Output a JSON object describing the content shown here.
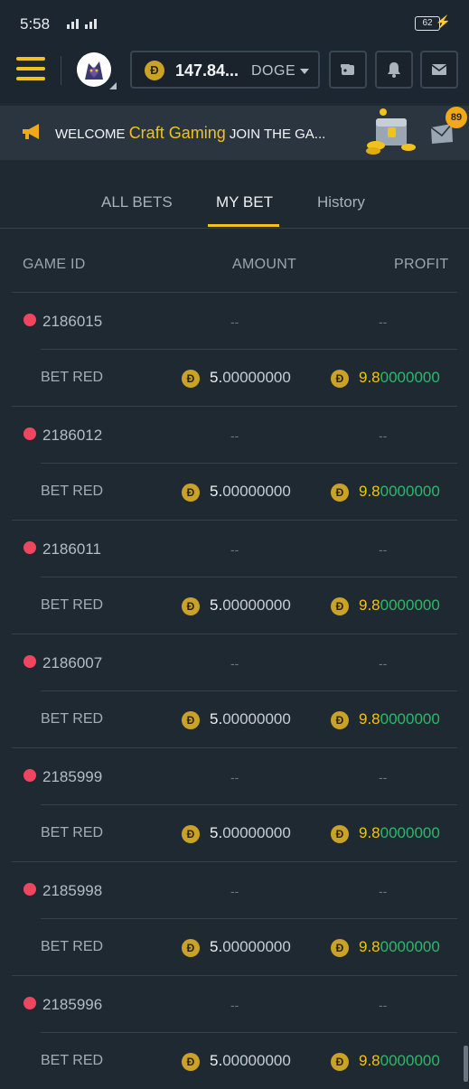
{
  "status_bar": {
    "time": "5:58",
    "battery": "62"
  },
  "header": {
    "balance": "147.84...",
    "currency": "DOGE",
    "coin_symbol": "Ð"
  },
  "banner": {
    "prefix": "WELCOME",
    "highlight": "Craft Gaming",
    "suffix": "JOIN THE GA...",
    "badge_count": "89"
  },
  "tabs": [
    {
      "label": "ALL BETS",
      "active": false
    },
    {
      "label": "MY BET",
      "active": true
    },
    {
      "label": "History",
      "active": false
    }
  ],
  "table": {
    "headers": {
      "game_id": "GAME ID",
      "amount": "AMOUNT",
      "profit": "PROFIT"
    },
    "rows": [
      {
        "game_id": "2186015",
        "placeholder": "--",
        "bet": "BET RED",
        "amount_main": "5.",
        "amount_rest": "00000000",
        "profit_main": "9.8",
        "profit_rest": "0000000"
      },
      {
        "game_id": "2186012",
        "placeholder": "--",
        "bet": "BET RED",
        "amount_main": "5.",
        "amount_rest": "00000000",
        "profit_main": "9.8",
        "profit_rest": "0000000"
      },
      {
        "game_id": "2186011",
        "placeholder": "--",
        "bet": "BET RED",
        "amount_main": "5.",
        "amount_rest": "00000000",
        "profit_main": "9.8",
        "profit_rest": "0000000"
      },
      {
        "game_id": "2186007",
        "placeholder": "--",
        "bet": "BET RED",
        "amount_main": "5.",
        "amount_rest": "00000000",
        "profit_main": "9.8",
        "profit_rest": "0000000"
      },
      {
        "game_id": "2185999",
        "placeholder": "--",
        "bet": "BET RED",
        "amount_main": "5.",
        "amount_rest": "00000000",
        "profit_main": "9.8",
        "profit_rest": "0000000"
      },
      {
        "game_id": "2185998",
        "placeholder": "--",
        "bet": "BET RED",
        "amount_main": "5.",
        "amount_rest": "00000000",
        "profit_main": "9.8",
        "profit_rest": "0000000"
      },
      {
        "game_id": "2185996",
        "placeholder": "--",
        "bet": "BET RED",
        "amount_main": "5.",
        "amount_rest": "00000000",
        "profit_main": "9.8",
        "profit_rest": "0000000"
      }
    ]
  },
  "colors": {
    "background": "#1f2932",
    "accent": "#f2c21c",
    "red_dot": "#f0455f",
    "profit_green": "#2fb66a"
  }
}
